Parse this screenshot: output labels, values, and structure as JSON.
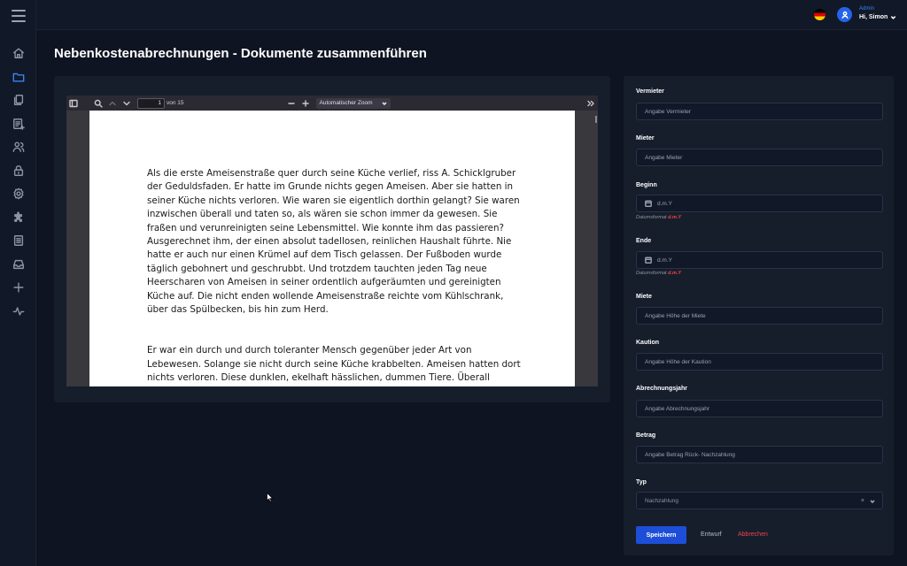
{
  "header": {
    "user_role": "Admin",
    "user_greeting": "Hi, Simon",
    "flag": "de-flag-icon"
  },
  "sidebar": {
    "items": [
      {
        "icon": "home-icon"
      },
      {
        "icon": "folder-icon",
        "active": true
      },
      {
        "icon": "documents-icon"
      },
      {
        "icon": "list-add-icon"
      },
      {
        "icon": "users-icon"
      },
      {
        "icon": "lock-icon"
      },
      {
        "icon": "settings-icon"
      },
      {
        "icon": "puzzle-icon"
      },
      {
        "icon": "document-list-icon"
      },
      {
        "icon": "inbox-icon"
      },
      {
        "icon": "plus-icon"
      },
      {
        "icon": "activity-icon"
      }
    ]
  },
  "page": {
    "title": "Nebenkostenabrechnungen - Dokumente zusammenführen"
  },
  "pdf_viewer": {
    "page_number": "1",
    "page_count_label": "von 15",
    "zoom_label": "Automatischer Zoom",
    "paragraphs": [
      "Als die erste Ameisenstraße quer durch seine Küche verlief, riss A. Schicklgruber der Geduldsfaden. Er hatte im Grunde nichts gegen Ameisen. Aber sie hatten in seiner Küche nichts verloren. Wie waren sie eigentlich dorthin gelangt? Sie waren inzwischen überall und taten so, als wären sie schon immer da gewesen. Sie fraßen und verunreinigten seine Lebensmittel. Wie konnte ihm das passieren? Ausgerechnet ihm, der einen absolut tadellosen, reinlichen Haushalt führte. Nie hatte er auch nur einen Krümel auf dem Tisch gelassen. Der Fußboden wurde täglich gebohnert und geschrubbt. Und trotzdem tauchten jeden Tag neue Heerscharen von Ameisen in seiner ordentlich aufgeräumten und gereinigten Küche auf. Die nicht enden wollende Ameisenstraße reichte vom Kühlschrank, über das Spülbecken, bis hin zum Herd.",
      "Er war ein durch und durch toleranter Mensch gegenüber jeder Art von Lebewesen. Solange sie nicht durch seine Küche krabbelten. Ameisen hatten dort nichts verloren. Diese dunklen, ekelhaft hässlichen, dummen Tiere. Überall klebten sie am Honig und verdarben ihm den Appetit. Diese Schmarotzer waren überflüssig wie ein Kropf, fand er."
    ]
  },
  "form": {
    "vermieter": {
      "label": "Vermieter",
      "placeholder": "Angabe Vermieter"
    },
    "mieter": {
      "label": "Mieter",
      "placeholder": "Angabe Mieter"
    },
    "beginn": {
      "label": "Beginn",
      "placeholder": "d.m.Y",
      "help_prefix": "Datumsformat",
      "help_format": "d.m.Y"
    },
    "ende": {
      "label": "Ende",
      "placeholder": "d.m.Y",
      "help_prefix": "Datumsformat",
      "help_format": "d.m.Y"
    },
    "miete": {
      "label": "Miete",
      "placeholder": "Angabe Höhe der Miete"
    },
    "kaution": {
      "label": "Kaution",
      "placeholder": "Angabe Höhe der Kaution"
    },
    "abrechnungsjahr": {
      "label": "Abrechnungsjahr",
      "placeholder": "Angabe Abrechnungsjahr"
    },
    "betrag": {
      "label": "Betrag",
      "placeholder": "Angabe Betrag Rück- Nachzahlung"
    },
    "typ": {
      "label": "Typ",
      "selected": "Nachzahlung",
      "clear": "×"
    },
    "actions": {
      "save": "Speichern",
      "draft": "Entwurf",
      "cancel": "Abbrechen"
    }
  },
  "colors": {
    "background": "#0e1421",
    "card": "#161e2c",
    "accent": "#1d4ed8",
    "danger": "#ef4444"
  }
}
